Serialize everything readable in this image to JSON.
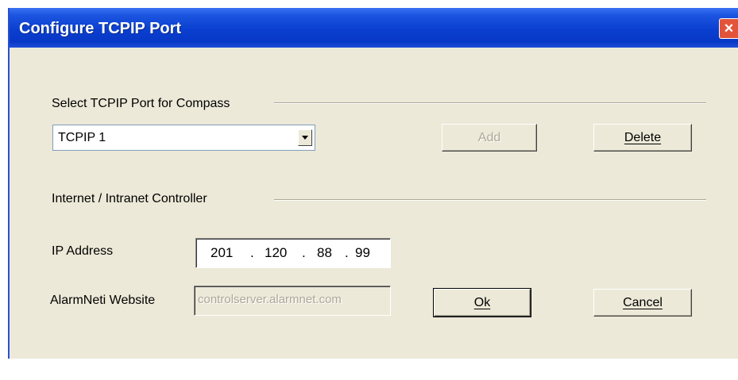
{
  "window": {
    "title": "Configure TCPIP Port",
    "close_glyph": "×"
  },
  "port_section": {
    "heading": "Select TCPIP Port for Compass",
    "selected_port": "TCPIP 1",
    "add_label": "Add",
    "delete_label": "Delete"
  },
  "controller_section": {
    "heading": "Internet / Intranet Controller",
    "ip_label": "IP Address",
    "ip_octets": [
      "201",
      "120",
      "88",
      "99"
    ],
    "website_label": "AlarmNeti Website",
    "website_value": "controlserver.alarmnet.com"
  },
  "buttons": {
    "ok_label": "Ok",
    "cancel_label": "Cancel"
  },
  "colors": {
    "titlebar": "#0a3fcf",
    "dialog_bg": "#ece9d8",
    "close": "#e2543a"
  }
}
